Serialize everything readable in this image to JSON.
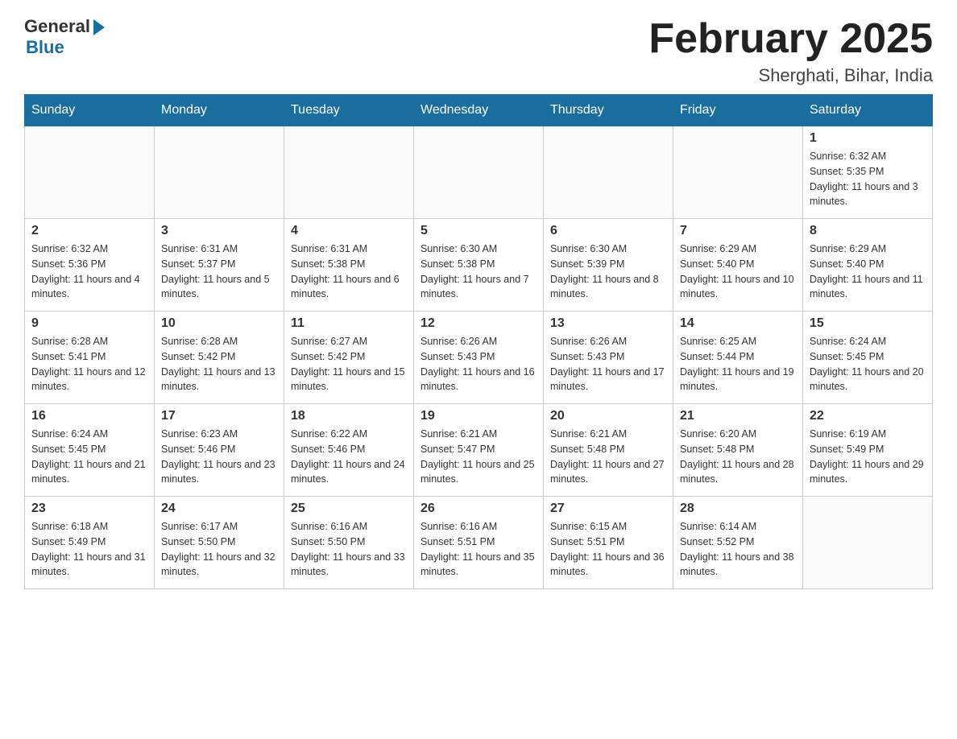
{
  "logo": {
    "general": "General",
    "blue": "Blue"
  },
  "title": {
    "month": "February 2025",
    "location": "Sherghati, Bihar, India"
  },
  "weekdays": [
    "Sunday",
    "Monday",
    "Tuesday",
    "Wednesday",
    "Thursday",
    "Friday",
    "Saturday"
  ],
  "weeks": [
    [
      {
        "day": "",
        "info": ""
      },
      {
        "day": "",
        "info": ""
      },
      {
        "day": "",
        "info": ""
      },
      {
        "day": "",
        "info": ""
      },
      {
        "day": "",
        "info": ""
      },
      {
        "day": "",
        "info": ""
      },
      {
        "day": "1",
        "info": "Sunrise: 6:32 AM\nSunset: 5:35 PM\nDaylight: 11 hours and 3 minutes."
      }
    ],
    [
      {
        "day": "2",
        "info": "Sunrise: 6:32 AM\nSunset: 5:36 PM\nDaylight: 11 hours and 4 minutes."
      },
      {
        "day": "3",
        "info": "Sunrise: 6:31 AM\nSunset: 5:37 PM\nDaylight: 11 hours and 5 minutes."
      },
      {
        "day": "4",
        "info": "Sunrise: 6:31 AM\nSunset: 5:38 PM\nDaylight: 11 hours and 6 minutes."
      },
      {
        "day": "5",
        "info": "Sunrise: 6:30 AM\nSunset: 5:38 PM\nDaylight: 11 hours and 7 minutes."
      },
      {
        "day": "6",
        "info": "Sunrise: 6:30 AM\nSunset: 5:39 PM\nDaylight: 11 hours and 8 minutes."
      },
      {
        "day": "7",
        "info": "Sunrise: 6:29 AM\nSunset: 5:40 PM\nDaylight: 11 hours and 10 minutes."
      },
      {
        "day": "8",
        "info": "Sunrise: 6:29 AM\nSunset: 5:40 PM\nDaylight: 11 hours and 11 minutes."
      }
    ],
    [
      {
        "day": "9",
        "info": "Sunrise: 6:28 AM\nSunset: 5:41 PM\nDaylight: 11 hours and 12 minutes."
      },
      {
        "day": "10",
        "info": "Sunrise: 6:28 AM\nSunset: 5:42 PM\nDaylight: 11 hours and 13 minutes."
      },
      {
        "day": "11",
        "info": "Sunrise: 6:27 AM\nSunset: 5:42 PM\nDaylight: 11 hours and 15 minutes."
      },
      {
        "day": "12",
        "info": "Sunrise: 6:26 AM\nSunset: 5:43 PM\nDaylight: 11 hours and 16 minutes."
      },
      {
        "day": "13",
        "info": "Sunrise: 6:26 AM\nSunset: 5:43 PM\nDaylight: 11 hours and 17 minutes."
      },
      {
        "day": "14",
        "info": "Sunrise: 6:25 AM\nSunset: 5:44 PM\nDaylight: 11 hours and 19 minutes."
      },
      {
        "day": "15",
        "info": "Sunrise: 6:24 AM\nSunset: 5:45 PM\nDaylight: 11 hours and 20 minutes."
      }
    ],
    [
      {
        "day": "16",
        "info": "Sunrise: 6:24 AM\nSunset: 5:45 PM\nDaylight: 11 hours and 21 minutes."
      },
      {
        "day": "17",
        "info": "Sunrise: 6:23 AM\nSunset: 5:46 PM\nDaylight: 11 hours and 23 minutes."
      },
      {
        "day": "18",
        "info": "Sunrise: 6:22 AM\nSunset: 5:46 PM\nDaylight: 11 hours and 24 minutes."
      },
      {
        "day": "19",
        "info": "Sunrise: 6:21 AM\nSunset: 5:47 PM\nDaylight: 11 hours and 25 minutes."
      },
      {
        "day": "20",
        "info": "Sunrise: 6:21 AM\nSunset: 5:48 PM\nDaylight: 11 hours and 27 minutes."
      },
      {
        "day": "21",
        "info": "Sunrise: 6:20 AM\nSunset: 5:48 PM\nDaylight: 11 hours and 28 minutes."
      },
      {
        "day": "22",
        "info": "Sunrise: 6:19 AM\nSunset: 5:49 PM\nDaylight: 11 hours and 29 minutes."
      }
    ],
    [
      {
        "day": "23",
        "info": "Sunrise: 6:18 AM\nSunset: 5:49 PM\nDaylight: 11 hours and 31 minutes."
      },
      {
        "day": "24",
        "info": "Sunrise: 6:17 AM\nSunset: 5:50 PM\nDaylight: 11 hours and 32 minutes."
      },
      {
        "day": "25",
        "info": "Sunrise: 6:16 AM\nSunset: 5:50 PM\nDaylight: 11 hours and 33 minutes."
      },
      {
        "day": "26",
        "info": "Sunrise: 6:16 AM\nSunset: 5:51 PM\nDaylight: 11 hours and 35 minutes."
      },
      {
        "day": "27",
        "info": "Sunrise: 6:15 AM\nSunset: 5:51 PM\nDaylight: 11 hours and 36 minutes."
      },
      {
        "day": "28",
        "info": "Sunrise: 6:14 AM\nSunset: 5:52 PM\nDaylight: 11 hours and 38 minutes."
      },
      {
        "day": "",
        "info": ""
      }
    ]
  ]
}
